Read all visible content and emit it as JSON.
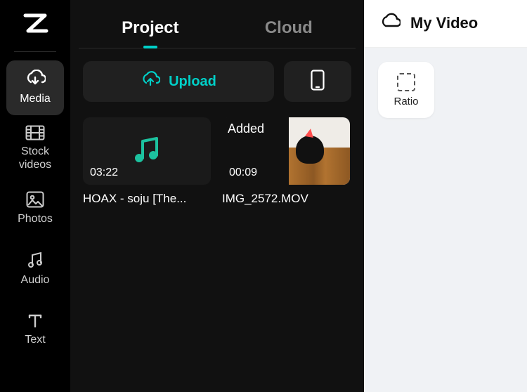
{
  "sidebar": {
    "items": [
      {
        "label": "Media"
      },
      {
        "label": "Stock videos"
      },
      {
        "label": "Photos"
      },
      {
        "label": "Audio"
      },
      {
        "label": "Text"
      }
    ]
  },
  "tabs": {
    "project": "Project",
    "cloud": "Cloud"
  },
  "actions": {
    "upload_label": "Upload"
  },
  "media": [
    {
      "duration": "03:22",
      "caption": "HOAX - soju [The...",
      "type": "audio"
    },
    {
      "duration": "00:09",
      "caption": "IMG_2572.MOV",
      "type": "video",
      "added_label": "Added"
    }
  ],
  "right": {
    "title": "My Video",
    "ratio_label": "Ratio"
  },
  "colors": {
    "accent": "#00d0c8"
  }
}
